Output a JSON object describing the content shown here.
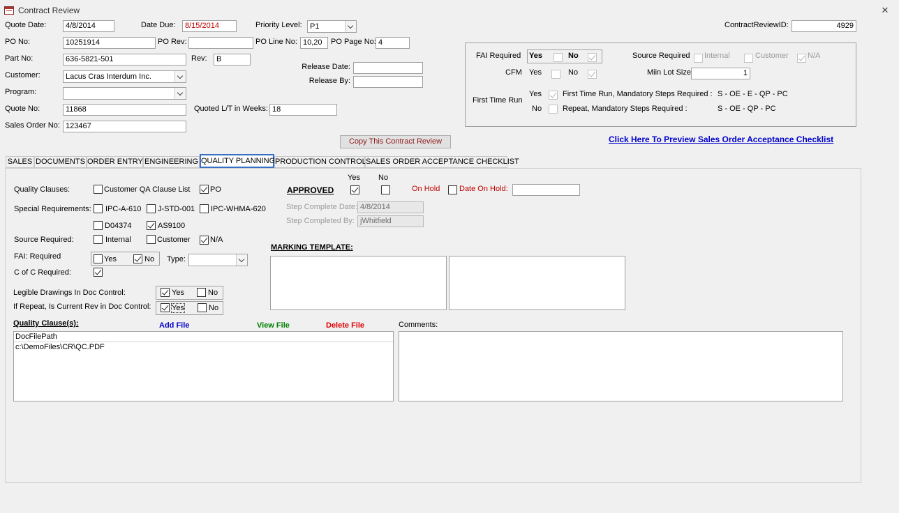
{
  "window": {
    "title": "Contract Review",
    "close_glyph": "✕"
  },
  "header": {
    "quote_date": {
      "label": "Quote Date:",
      "value": "4/8/2014"
    },
    "date_due": {
      "label": "Date Due:",
      "value": "8/15/2014"
    },
    "priority": {
      "label": "Priority Level:",
      "value": "P1"
    },
    "contract_review_id": {
      "label": "ContractReviewID:",
      "value": "4929"
    },
    "po_no": {
      "label": "PO No:",
      "value": "10251914"
    },
    "po_rev": {
      "label": "PO Rev:",
      "value": ""
    },
    "po_line_no": {
      "label": "PO Line No:",
      "value": "10,20"
    },
    "po_page_no": {
      "label": "PO Page No:",
      "value": "4"
    },
    "part_no": {
      "label": "Part No:",
      "value": "636-5821-501"
    },
    "rev": {
      "label": "Rev:",
      "value": "B"
    },
    "customer": {
      "label": "Customer:",
      "value": "Lacus Cras Interdum Inc."
    },
    "program": {
      "label": "Program:",
      "value": ""
    },
    "release_date": {
      "label": "Release Date:",
      "value": ""
    },
    "release_by": {
      "label": "Release By:",
      "value": ""
    },
    "quote_no": {
      "label": "Quote No:",
      "value": "11868"
    },
    "quoted_lt": {
      "label": "Quoted L/T in Weeks:",
      "value": "18"
    },
    "sales_order_no": {
      "label": "Sales Order No:",
      "value": "123467"
    },
    "copy_button": "Copy This Contract Review",
    "preview_link": "Click Here To Preview Sales Order Acceptance Checklist"
  },
  "fai_panel": {
    "fai_required_label": "FAI Required",
    "yes": "Yes",
    "no": "No",
    "cfm_label": "CFM",
    "source_required_label": "Source Required",
    "internal": "Internal",
    "customer": "Customer",
    "na": "N/A",
    "min_lot_label": "Miin Lot Size",
    "min_lot_value": "1",
    "first_time_run_label": "First Time Run",
    "first_time_text": "First Time Run, Mandatory Steps Required :",
    "first_time_steps": "S  -  OE   -  E  -  QP - PC",
    "repeat_text": "Repeat, Mandatory Steps Required :",
    "repeat_steps": "S  -  OE   -  QP - PC"
  },
  "tabs": [
    {
      "label": "SALES"
    },
    {
      "label": "DOCUMENTS"
    },
    {
      "label": "ORDER ENTRY"
    },
    {
      "label": "ENGINEERING"
    },
    {
      "label": "QUALITY PLANNING"
    },
    {
      "label": "PRODUCTION CONTROL"
    },
    {
      "label": "SALES ORDER ACCEPTANCE CHECKLIST"
    }
  ],
  "qp": {
    "quality_clauses_label": "Quality Clauses:",
    "customer_qa_clause_list": "Customer QA Clause List",
    "po": "PO",
    "special_requirements_label": "Special Requirements:",
    "ipc_a_610": "IPC-A-610",
    "j_std_001": "J-STD-001",
    "ipc_whma_620": "IPC-WHMA-620",
    "d04374": "D04374",
    "as9100": "AS9100",
    "source_required_label": "Source Required:",
    "internal": "Internal",
    "customer": "Customer",
    "na": "N/A",
    "fai_required_label": "FAI: Required",
    "yes": "Yes",
    "no": "No",
    "type_label": "Type:",
    "type_value": "",
    "coc_label": "C of C Required:",
    "legible_label": "Legible Drawings In Doc Control:",
    "repeat_rev_label": "If Repeat, Is Current Rev in Doc Control:",
    "approved_label": "APPROVED",
    "yes_col": "Yes",
    "no_col": "No",
    "on_hold": "On Hold",
    "date_on_hold_label": "Date On Hold:",
    "date_on_hold_value": "",
    "step_complete_date_label": "Step Complete Date:",
    "step_complete_date": "4/8/2014",
    "step_completed_by_label": "Step Completed By:",
    "step_completed_by": "jWhitfield",
    "marking_template_label": "MARKING TEMPLATE:",
    "quality_clauses_list_label": "Quality Clause(s):",
    "add_file": "Add File",
    "view_file": "View File",
    "delete_file": "Delete File",
    "comments_label": "Comments:",
    "file_list_header": "DocFilePath",
    "file_list_rows": [
      "c:\\DemoFiles\\CR\\QC.PDF"
    ]
  }
}
